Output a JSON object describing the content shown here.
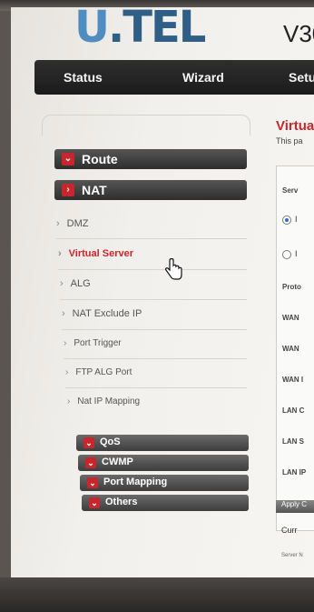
{
  "header": {
    "logo": {
      "u": "U",
      "rest": ".TEL"
    },
    "model": "V30"
  },
  "nav": {
    "tabs": [
      {
        "label": "Status"
      },
      {
        "label": "Wizard"
      },
      {
        "label": "Setu"
      }
    ]
  },
  "sidebar": {
    "route_label": "Route",
    "nat_label": "NAT",
    "nat_items": [
      {
        "label": "DMZ"
      },
      {
        "label": "Virtual Server"
      },
      {
        "label": "ALG"
      },
      {
        "label": "NAT Exclude IP"
      },
      {
        "label": "Port Trigger"
      },
      {
        "label": "FTP ALG Port"
      },
      {
        "label": "Nat IP Mapping"
      }
    ],
    "bottom_sections": [
      {
        "label": "QoS"
      },
      {
        "label": "CWMP"
      },
      {
        "label": "Port Mapping"
      },
      {
        "label": "Others"
      }
    ]
  },
  "main": {
    "title": "Virtua",
    "description": "This pa",
    "fields": {
      "server": "Serv",
      "protocol": "Proto",
      "wan1": "WAN",
      "wan2": "WAN",
      "wan3": "WAN I",
      "lan1": "LAN C",
      "lan2": "LAN S",
      "lan3": "LAN IP"
    },
    "radio1": "I",
    "radio2": "I",
    "apply_label": "Apply C",
    "current_label": "Curr",
    "server_name_small": "Server N"
  },
  "colors": {
    "accent": "#c7262c",
    "navbar": "#1b1b1b",
    "logo": "#2f5f86"
  }
}
